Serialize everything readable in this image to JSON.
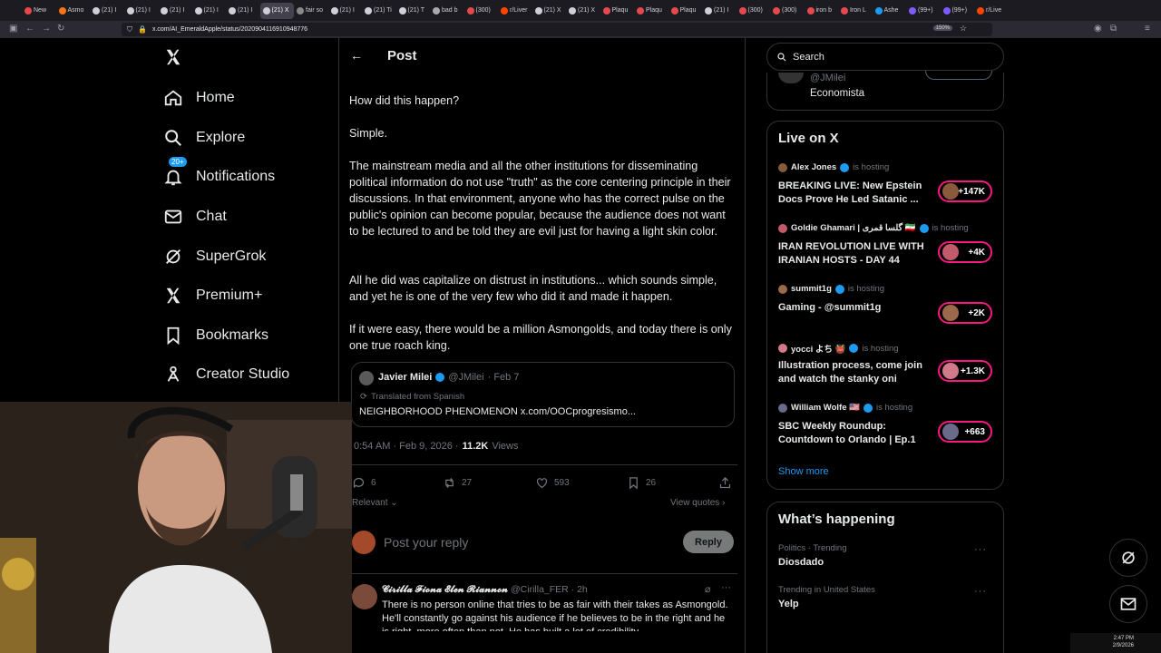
{
  "browser": {
    "tabs": [
      "New",
      "Asmo",
      "(21) I",
      "(21) I",
      "(21) I",
      "(21) I",
      "(21) I",
      "(21) X",
      "fair so",
      "(21) I",
      "(21) Ti",
      "(21) T",
      "bad b",
      "(300)",
      "r/Liver",
      "(21) X",
      "(21) X",
      "Plaqu",
      "Plaqu",
      "Plaqu",
      "(21) I",
      "(300)",
      "(300)",
      "iron b",
      "Iron L",
      "Ashe",
      "(99+)",
      "(99+)",
      "r/Live"
    ],
    "active_tab_index": 7,
    "url": "x.com/AI_EmeraldApple/status/2020904116910948776",
    "zoom": "150%"
  },
  "nav": {
    "items": [
      {
        "label": "Home",
        "icon": "home-icon"
      },
      {
        "label": "Explore",
        "icon": "search-icon"
      },
      {
        "label": "Notifications",
        "icon": "bell-icon",
        "badge": "20+"
      },
      {
        "label": "Chat",
        "icon": "mail-icon"
      },
      {
        "label": "SuperGrok",
        "icon": "grok-icon"
      },
      {
        "label": "Premium+",
        "icon": "x-logo-icon"
      },
      {
        "label": "Bookmarks",
        "icon": "bookmark-icon"
      },
      {
        "label": "Creator Studio",
        "icon": "creator-studio-icon"
      }
    ]
  },
  "post": {
    "header": "Post",
    "paragraphs": [
      "How did this happen?",
      "Simple.",
      "The mainstream media and all the other institutions for disseminating political information do not use \"truth\" as the core centering principle in their discussions. In that environment, anyone who has the correct pulse on the public's opinion can become popular, because the audience does not want to be lectured to and be told they are evil just for having a light skin color.",
      "All he did was capitalize on distrust in institutions... which sounds simple, and yet he is one of the very few who did it and made it happen.",
      "If it were easy, there would be a million Asmongolds, and today there is only one true roach king."
    ],
    "quote": {
      "name": "Javier Milei",
      "handle": "@JMilei",
      "date": "· Feb 7",
      "translated": "Translated from Spanish",
      "text": "NEIGHBORHOOD PHENOMENON x.com/OOCprogresismo..."
    },
    "timestamp": "0:54 AM · Feb 9, 2026 ·",
    "views_count": "11.2K",
    "views_label": "Views",
    "stats": {
      "replies": "6",
      "reposts": "27",
      "likes": "593",
      "bookmarks": "26"
    },
    "relevant": "Relevant",
    "view_quotes": "View quotes",
    "reply_placeholder": "Post your reply",
    "reply_button": "Reply"
  },
  "reply_tweet": {
    "name": "𝓒𝓲𝓻𝓲𝓵𝓵𝓪 𝓕𝓲𝓸𝓷𝓪 𝓔𝓵𝓮𝓷 𝓡𝓲𝓪𝓷𝓷𝓸𝓷",
    "handle": "@Cirilla_FER · 2h",
    "text": "There is no person online that tries to be as fair with their takes as Asmongold. He'll constantly go against his audience if he believes to be in the right and he is right, more often than not. He has built a lot of credibility"
  },
  "right": {
    "search_placeholder": "Search",
    "profile_handle": "@JMilei",
    "profile_bio": "Economista",
    "live": {
      "title": "Live on X",
      "hosting_label": "is hosting",
      "items": [
        {
          "host": "Alex Jones",
          "title": "BREAKING LIVE: New Epstein Docs Prove He Led Satanic ...",
          "count": "+147K",
          "color": "#8a5a3c"
        },
        {
          "host": "Goldie Ghamari | گلسا قمری 🇮🇷",
          "title": "IRAN REVOLUTION LIVE WITH IRANIAN HOSTS - DAY 44",
          "count": "+4K",
          "color": "#c25a6a"
        },
        {
          "host": "summit1g",
          "title": "Gaming - @summit1g",
          "count": "+2K",
          "color": "#9a6a4a"
        },
        {
          "host": "yocci よち 👹",
          "title": "Illustration process, come join and watch the stanky oni",
          "count": "+1.3K",
          "color": "#d07a8a"
        },
        {
          "host": "William Wolfe 🇺🇸",
          "title": "SBC Weekly Roundup: Countdown to Orlando | Ep.1",
          "count": "+663",
          "color": "#6a6a8a"
        }
      ],
      "show_more": "Show more"
    },
    "happening": {
      "title": "What’s happening",
      "items": [
        {
          "meta": "Politics · Trending",
          "name": "Diosdado"
        },
        {
          "meta": "Trending in United States",
          "name": "Yelp"
        }
      ]
    }
  },
  "system": {
    "time": "2:47 PM",
    "date": "2/9/2026"
  },
  "colors": {
    "accent": "#1d9bf0",
    "live": "#f91880",
    "border": "#2f3336",
    "muted": "#71767b"
  }
}
